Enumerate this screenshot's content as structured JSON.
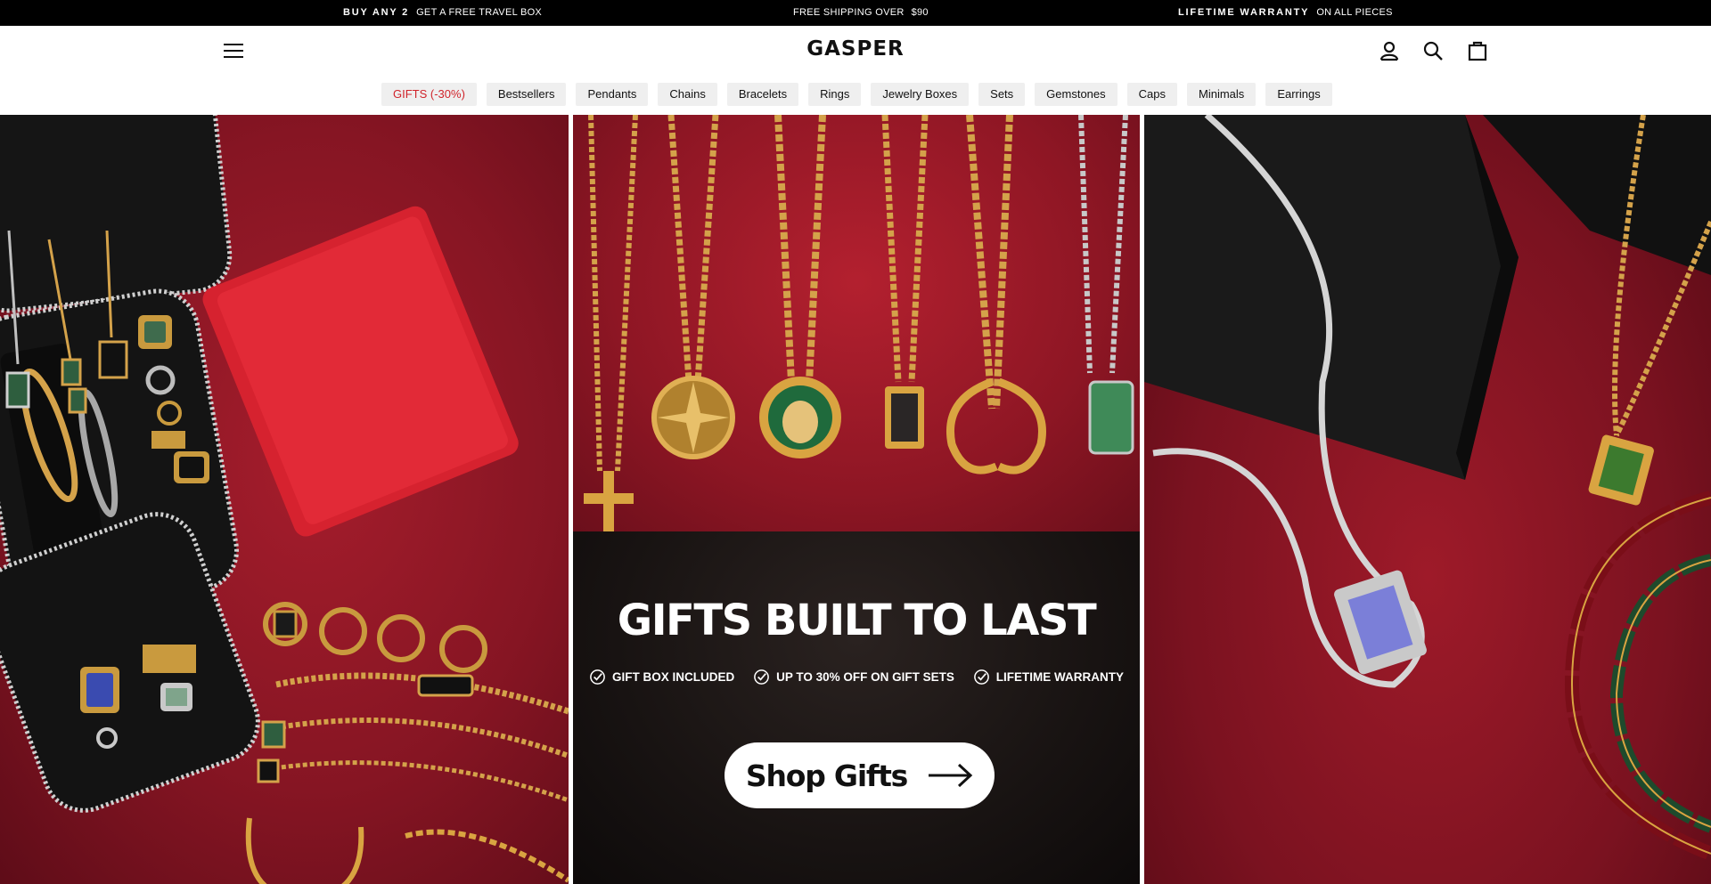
{
  "announcement": {
    "m1_bold": "BUY ANY 2",
    "m1_text": "GET A FREE TRAVEL BOX",
    "m2_text": "FREE SHIPPING OVER",
    "m2_amount": "$90",
    "m3_bold": "LIFETIME WARRANTY",
    "m3_text": "ON ALL PIECES"
  },
  "header": {
    "logo": "GASPER",
    "icons": [
      "menu-icon",
      "account-icon",
      "search-icon",
      "cart-icon"
    ]
  },
  "categories": [
    "GIFTS (-30%)",
    "Bestsellers",
    "Pendants",
    "Chains",
    "Bracelets",
    "Rings",
    "Jewelry Boxes",
    "Sets",
    "Gemstones",
    "Caps",
    "Minimals",
    "Earrings"
  ],
  "hero": {
    "title": "GIFTS BUILT TO LAST",
    "perks": [
      "GIFT BOX INCLUDED",
      "UP TO 30% OFF ON GIFT SETS",
      "LIFETIME WARRANTY"
    ],
    "cta_label": "Shop Gifts"
  },
  "colors": {
    "sale": "#d0242b",
    "announce_bg": "#000000",
    "hero_red": "#8e1624",
    "gold": "#d9a441"
  }
}
